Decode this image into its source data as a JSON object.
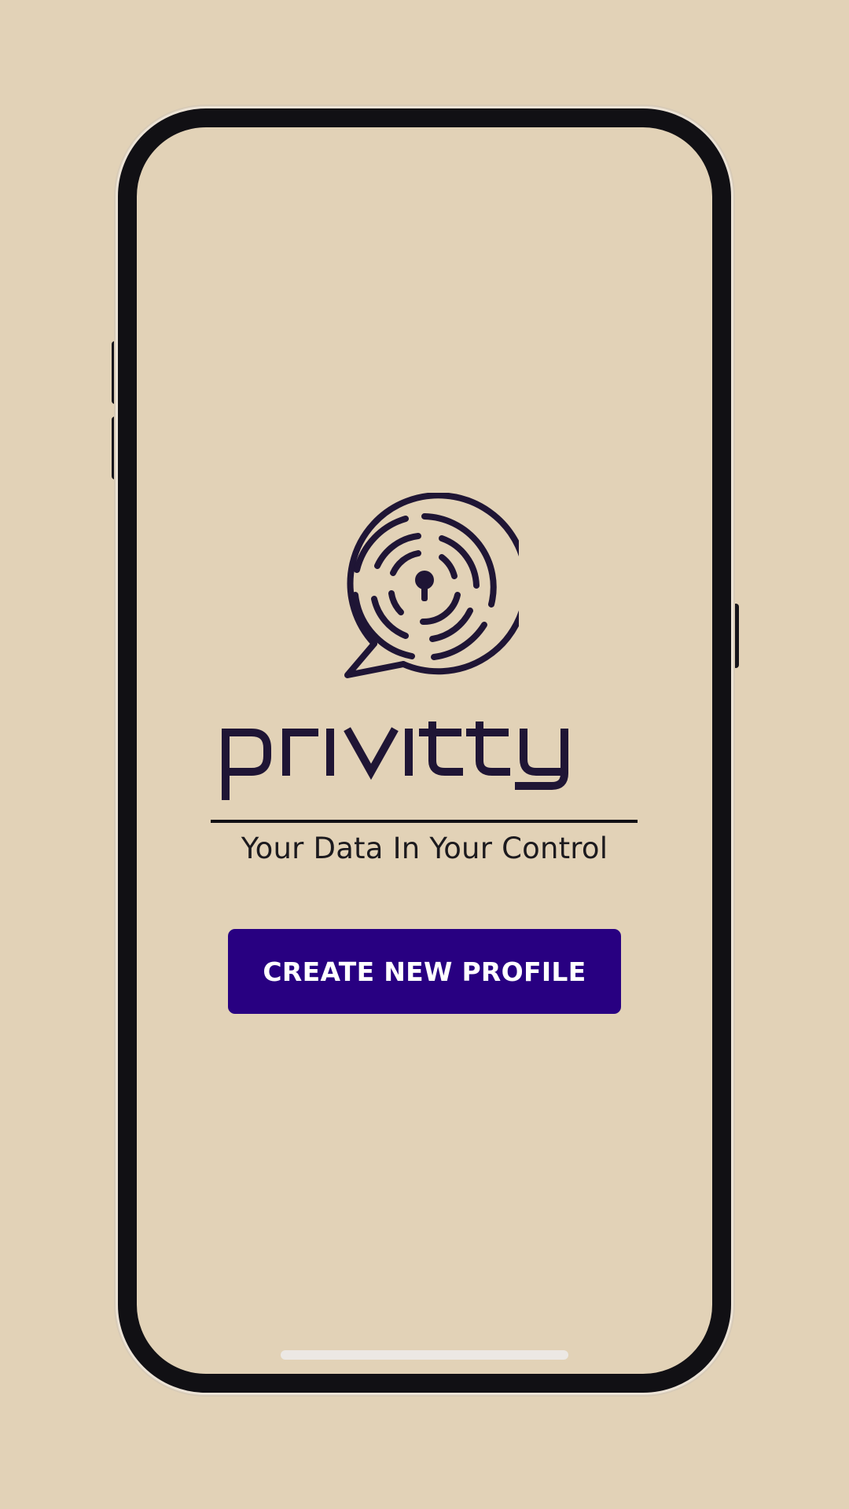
{
  "app": {
    "brand_name": "privitty",
    "tagline": "Your Data In Your Control",
    "logo_icon": "chat-bubble-maze-keyhole-icon"
  },
  "actions": {
    "create_profile_label": "CREATE NEW PROFILE"
  },
  "colors": {
    "background": "#e2d2b7",
    "brand_dark": "#1f1535",
    "button": "#280081",
    "button_text": "#ffffff",
    "frame": "#111014"
  }
}
